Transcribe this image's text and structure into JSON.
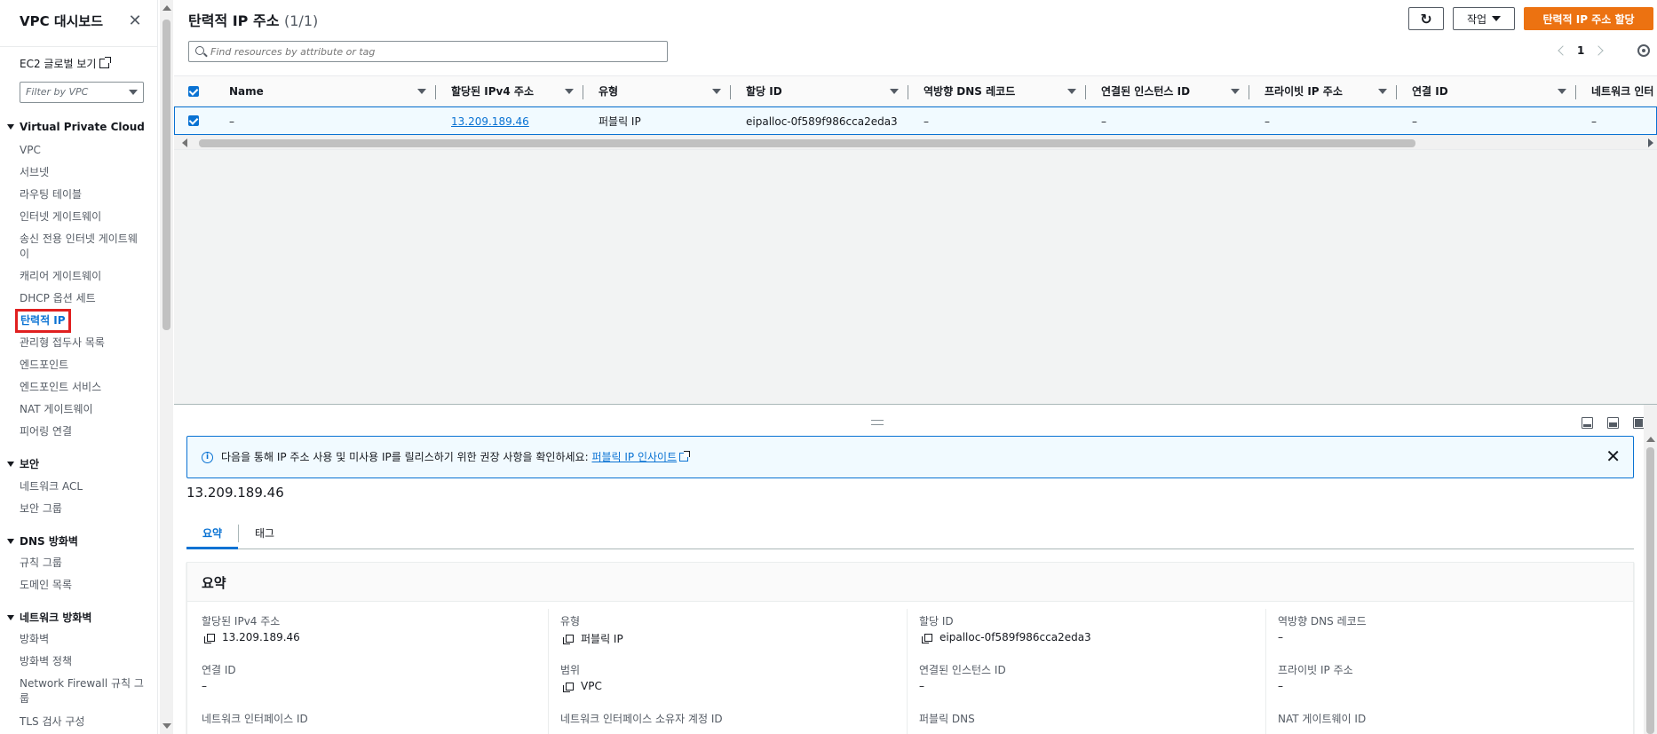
{
  "sidebar": {
    "title": "VPC 대시보드",
    "ec2_link": "EC2 글로벌 보기",
    "filter_placeholder": "Filter by VPC",
    "sections": [
      {
        "title": "Virtual Private Cloud"
      },
      {
        "title": "보안"
      },
      {
        "title": "DNS 방화벽"
      },
      {
        "title": "네트워크 방화벽"
      }
    ],
    "vpc_items": [
      "VPC",
      "서브넷",
      "라우팅 테이블",
      "인터넷 게이트웨이",
      "송신 전용 인터넷 게이트웨이",
      "캐리어 게이트웨이",
      "DHCP 옵션 세트",
      "탄력적 IP",
      "관리형 접두사 목록",
      "엔드포인트",
      "엔드포인트 서비스",
      "NAT 게이트웨이",
      "피어링 연결"
    ],
    "security_items": [
      "네트워크 ACL",
      "보안 그룹"
    ],
    "dns_items": [
      "규칙 그룹",
      "도메인 목록"
    ],
    "nfw_items": [
      "방화벽",
      "방화벽 정책",
      "Network Firewall 규칙 그룹",
      "TLS 검사 구성"
    ]
  },
  "header": {
    "title": "탄력적 IP 주소",
    "count": "(1/1)",
    "action_label": "작업",
    "primary_label": "탄력적 IP 주소 할당",
    "search_placeholder": "Find resources by attribute or tag",
    "page_number": "1"
  },
  "table": {
    "columns": [
      "Name",
      "할당된 IPv4 주소",
      "유형",
      "할당 ID",
      "역방향 DNS 레코드",
      "연결된 인스턴스 ID",
      "프라이빗 IP 주소",
      "연결 ID",
      "네트워크 인터"
    ],
    "rows": [
      [
        "–",
        "13.209.189.46",
        "퍼블릭 IP",
        "eipalloc-0f589f986cca2eda3",
        "–",
        "–",
        "–",
        "–",
        "–"
      ]
    ]
  },
  "details": {
    "banner_text": "다음을 통해 IP 주소 사용 및 미사용 IP를 릴리스하기 위한 권장 사항을 확인하세요:",
    "banner_link": "퍼블릭 IP 인사이트",
    "selected_ip": "13.209.189.46",
    "tabs": [
      "요약",
      "태그"
    ],
    "summary_title": "요약",
    "fields": [
      {
        "label": "할당된 IPv4 주소",
        "value": "13.209.189.46"
      },
      {
        "label": "유형",
        "value": "퍼블릭 IP"
      },
      {
        "label": "할당 ID",
        "value": "eipalloc-0f589f986cca2eda3"
      },
      {
        "label": "역방향 DNS 레코드",
        "value": "–"
      },
      {
        "label": "연결 ID",
        "value": "–"
      },
      {
        "label": "범위",
        "value": "VPC"
      },
      {
        "label": "연결된 인스턴스 ID",
        "value": "–"
      },
      {
        "label": "프라이빗 IP 주소",
        "value": "–"
      },
      {
        "label": "네트워크 인터페이스 ID",
        "value": ""
      },
      {
        "label": "네트워크 인터페이스 소유자 계정 ID",
        "value": ""
      },
      {
        "label": "퍼블릭 DNS",
        "value": ""
      },
      {
        "label": "NAT 게이트웨이 ID",
        "value": ""
      }
    ]
  },
  "colors": {
    "accent": "#0972d3",
    "primary_button": "#ec7211",
    "highlight_box": "#e02020"
  }
}
